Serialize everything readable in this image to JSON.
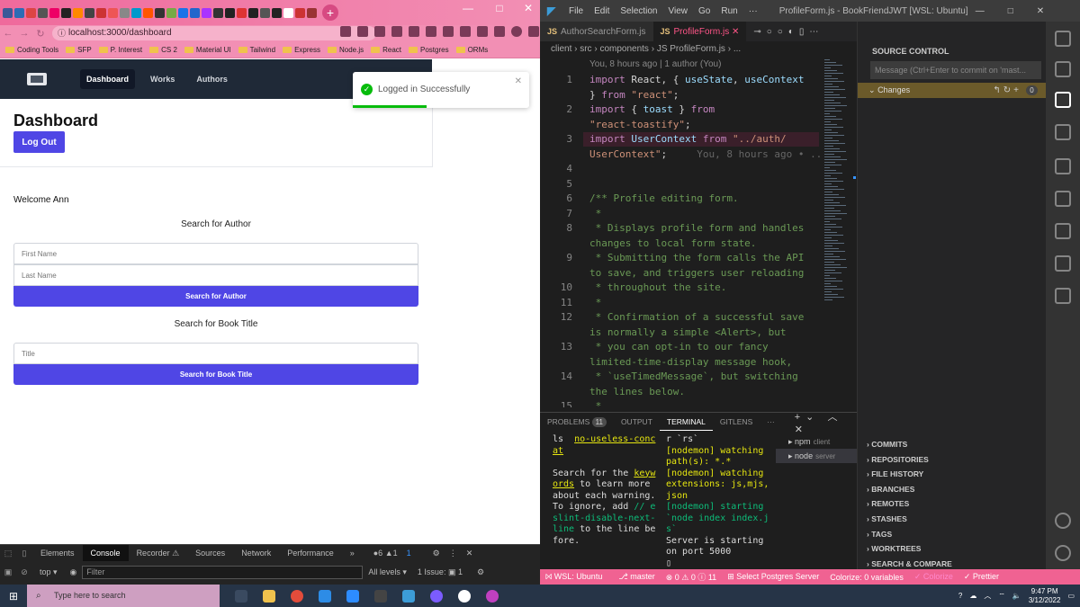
{
  "browser": {
    "url": "localhost:3000/dashboard",
    "bookmarks": [
      "Coding Tools",
      "SFP",
      "P. Interest",
      "CS 2",
      "Material UI",
      "Tailwind",
      "Express",
      "Node.js",
      "React",
      "Postgres",
      "ORMs"
    ],
    "tab_colors": [
      "#3b5998",
      "#2d6cb5",
      "#d44",
      "#555",
      "#e06",
      "#222",
      "#f80",
      "#444",
      "#c33",
      "#e55",
      "#888",
      "#09c",
      "#f50",
      "#333",
      "#7a4",
      "#1a73e8",
      "#26c",
      "#a3f",
      "#333",
      "#222",
      "#d33",
      "#222",
      "#555",
      "#222",
      "#fff",
      "#c33",
      "#933"
    ]
  },
  "app": {
    "nav": {
      "dashboard": "Dashboard",
      "works": "Works",
      "authors": "Authors"
    },
    "title": "Dashboard",
    "logout": "Log Out",
    "welcome": "Welcome Ann",
    "author_search": {
      "heading": "Search for Author",
      "first_placeholder": "First Name",
      "last_placeholder": "Last Name",
      "button": "Search for Author"
    },
    "book_search": {
      "heading": "Search for Book Title",
      "title_placeholder": "Title",
      "button": "Search for Book Title"
    },
    "toast": {
      "message": "Logged in Successfully",
      "progress": 0.42
    }
  },
  "devtools": {
    "tabs": [
      "Elements",
      "Console",
      "Recorder ⚠",
      "Sources",
      "Network",
      "Performance"
    ],
    "more": "»",
    "issues_counts": "●6 ▲1",
    "msg_count": "1",
    "context": "top ▾",
    "filter_placeholder": "Filter",
    "levels": "All levels ▾",
    "issue_badge": "1 Issue: ▣ 1"
  },
  "vscode": {
    "menu": [
      "File",
      "Edit",
      "Selection",
      "View",
      "Go",
      "Run",
      "···"
    ],
    "window_title": "ProfileForm.js - BookFriendJWT [WSL: Ubuntu] - V...",
    "tabs": [
      "AuthorSearchForm.js",
      "ProfileForm.js"
    ],
    "breadcrumb": "client › src › components › JS ProfileForm.js › ...",
    "blame": "You, 8 hours ago | 1 author (You)",
    "lines": [
      {
        "n": "1",
        "html": "<span class='kw'>import</span> React, { <span class='id'>useState</span>, <span class='id'>useContext</span>"
      },
      {
        "n": "",
        "html": "} <span class='kw'>from</span> <span class='str'>\"react\"</span>;"
      },
      {
        "n": "2",
        "html": "<span class='kw'>import</span> { <span class='id'>toast</span> } <span class='kw'>from</span>"
      },
      {
        "n": "",
        "html": "<span class='str'>\"react-toastify\"</span>;"
      },
      {
        "n": "3",
        "html": "<span class='kw'>import</span> <span class='id'>UserContext</span> <span class='kw'>from</span> <span class='str'>\"../auth/</span>"
      },
      {
        "n": "",
        "html": "<span class='str'>UserContext\"</span>;     <span style='color:#666'>You, 8 hours ago • ...</span>"
      },
      {
        "n": "4",
        "html": ""
      },
      {
        "n": "5",
        "html": ""
      },
      {
        "n": "6",
        "html": "<span class='cm'>/** Profile editing form.</span>"
      },
      {
        "n": "7",
        "html": "<span class='cm'> *</span>"
      },
      {
        "n": "8",
        "html": "<span class='cm'> * Displays profile form and handles</span>"
      },
      {
        "n": "",
        "html": "<span class='cm'>changes to local form state.</span>"
      },
      {
        "n": "9",
        "html": "<span class='cm'> * Submitting the form calls the API</span>"
      },
      {
        "n": "",
        "html": "<span class='cm'>to save, and triggers user reloading</span>"
      },
      {
        "n": "10",
        "html": "<span class='cm'> * throughout the site.</span>"
      },
      {
        "n": "11",
        "html": "<span class='cm'> *</span>"
      },
      {
        "n": "12",
        "html": "<span class='cm'> * Confirmation of a successful save</span>"
      },
      {
        "n": "",
        "html": "<span class='cm'>is normally a simple &lt;Alert&gt;, but</span>"
      },
      {
        "n": "13",
        "html": "<span class='cm'> * you can opt-in to our fancy</span>"
      },
      {
        "n": "",
        "html": "<span class='cm'>limited-time-display message hook,</span>"
      },
      {
        "n": "14",
        "html": "<span class='cm'> * `useTimedMessage`, but switching</span>"
      },
      {
        "n": "",
        "html": "<span class='cm'>the lines below.</span>"
      },
      {
        "n": "15",
        "html": "<span class='cm'> *</span>"
      }
    ],
    "scm": {
      "title": "SOURCE CONTROL",
      "commit_placeholder": "Message (Ctrl+Enter to commit on 'mast...",
      "changes": "Changes",
      "count": "0",
      "sections": [
        "COMMITS",
        "REPOSITORIES",
        "FILE HISTORY",
        "BRANCHES",
        "REMOTES",
        "STASHES",
        "TAGS",
        "WORKTREES",
        "SEARCH & COMPARE"
      ]
    },
    "panel": {
      "tabs": [
        "PROBLEMS",
        "OUTPUT",
        "TERMINAL",
        "GITLENS",
        "···"
      ],
      "problems_count": "11",
      "term_left": "<span>ls  <span class='yellow'><u>no-useless-conc</u></span></span>\n<span class='yellow'><u>at</u></span>\n\nSearch for the <span class='yellow'><u>keyw</u></span>\n<span class='yellow'><u>ords</u></span> to learn more\nabout each warning.\nTo ignore, add <span class='green'>// e</span>\n<span class='green'>slint-disable-next-</span>\n<span class='green'>line</span> to the line be\nfore.",
      "term_right": "r `rs`\n<span class='yellow'>[nodemon] watching</span>\n<span class='yellow'>path(s): *.*</span>\n<span class='yellow'>[nodemon] watching</span>\n<span class='yellow'>extensions: js,mjs,</span>\n<span class='yellow'>json</span>\n<span class='green'>[nodemon] starting</span>\n<span class='green'>`node index index.j</span>\n<span class='green'>s`</span>\nServer is starting\non port 5000\n▯",
      "terminals": [
        {
          "name": "npm",
          "sub": "client"
        },
        {
          "name": "node",
          "sub": "server"
        }
      ]
    },
    "status": [
      "WSL: Ubuntu",
      "master",
      "⊗ 0 ⚠ 0 ⓘ 11",
      "Select Postgres Server",
      "Colorize: 0 variables",
      "✓ Colorize",
      "✓ Prettier"
    ]
  },
  "taskbar": {
    "search_placeholder": "Type here to search",
    "time": "9:47 PM",
    "date": "3/12/2022"
  }
}
